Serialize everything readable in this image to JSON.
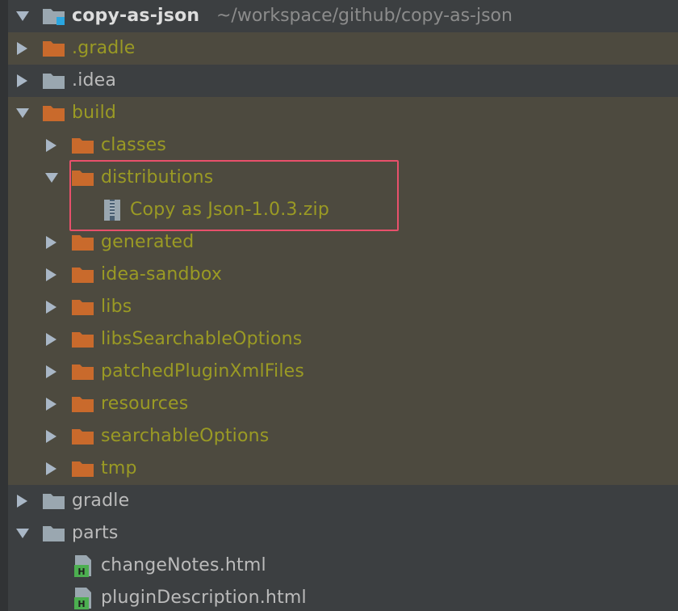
{
  "colors": {
    "panel_bg": "#3c3f41",
    "excluded_bg": "#4d4a3f",
    "excluded_text": "#9a9a24",
    "normal_text": "#bbbbbb",
    "folder_orange": "#c96a2c",
    "folder_gray": "#9aa7b0",
    "html_badge": "#4caf50",
    "highlight_border": "#e8506b"
  },
  "root": {
    "name": "copy-as-json",
    "path": "~/workspace/github/copy-as-json"
  },
  "items": [
    {
      "label": ".gradle",
      "icon": "folder-orange-icon",
      "arrow": "chevron-right-icon"
    },
    {
      "label": ".idea",
      "icon": "folder-gray-icon",
      "arrow": "chevron-right-icon"
    },
    {
      "label": "build",
      "icon": "folder-orange-icon",
      "arrow": "chevron-down-icon"
    },
    {
      "label": "classes",
      "icon": "folder-orange-icon",
      "arrow": "chevron-right-icon"
    },
    {
      "label": "distributions",
      "icon": "folder-orange-icon",
      "arrow": "chevron-down-icon"
    },
    {
      "label": "Copy as Json-1.0.3.zip",
      "icon": "zip-file-icon",
      "arrow": ""
    },
    {
      "label": "generated",
      "icon": "folder-orange-icon",
      "arrow": "chevron-right-icon"
    },
    {
      "label": "idea-sandbox",
      "icon": "folder-orange-icon",
      "arrow": "chevron-right-icon"
    },
    {
      "label": "libs",
      "icon": "folder-orange-icon",
      "arrow": "chevron-right-icon"
    },
    {
      "label": "libsSearchableOptions",
      "icon": "folder-orange-icon",
      "arrow": "chevron-right-icon"
    },
    {
      "label": "patchedPluginXmlFiles",
      "icon": "folder-orange-icon",
      "arrow": "chevron-right-icon"
    },
    {
      "label": "resources",
      "icon": "folder-orange-icon",
      "arrow": "chevron-right-icon"
    },
    {
      "label": "searchableOptions",
      "icon": "folder-orange-icon",
      "arrow": "chevron-right-icon"
    },
    {
      "label": "tmp",
      "icon": "folder-orange-icon",
      "arrow": "chevron-right-icon"
    },
    {
      "label": "gradle",
      "icon": "folder-gray-icon",
      "arrow": "chevron-right-icon"
    },
    {
      "label": "parts",
      "icon": "folder-gray-icon",
      "arrow": "chevron-down-icon"
    },
    {
      "label": "changeNotes.html",
      "icon": "html-file-icon",
      "arrow": ""
    },
    {
      "label": "pluginDescription.html",
      "icon": "html-file-icon",
      "arrow": ""
    }
  ]
}
